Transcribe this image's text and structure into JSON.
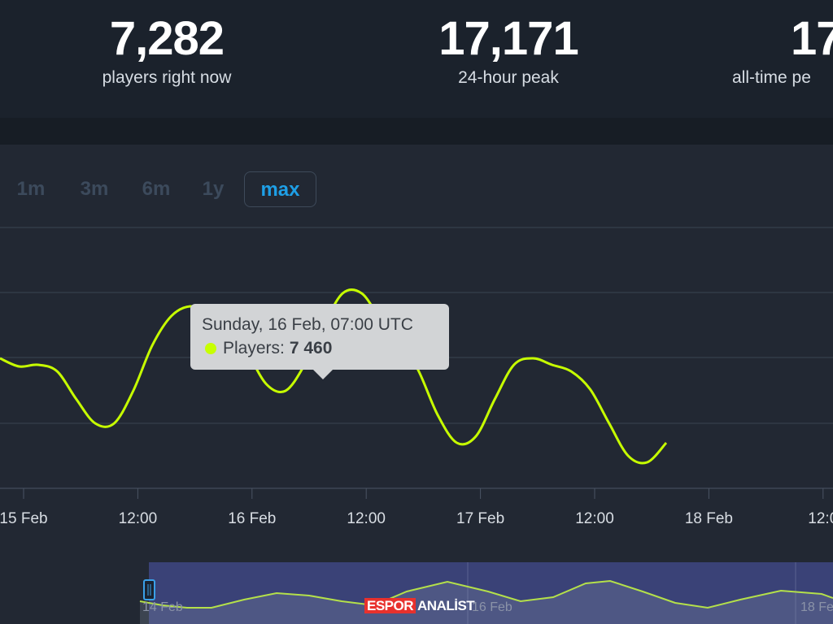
{
  "stats": [
    {
      "value": "7,282",
      "label": "players right now"
    },
    {
      "value": "17,171",
      "label": "24-hour peak"
    },
    {
      "value": "17",
      "label": "all-time pe"
    }
  ],
  "range_buttons": [
    {
      "label": "1m",
      "active": false
    },
    {
      "label": "3m",
      "active": false
    },
    {
      "label": "6m",
      "active": false
    },
    {
      "label": "1y",
      "active": false
    },
    {
      "label": "max",
      "active": true
    }
  ],
  "tooltip": {
    "title": "Sunday, 16 Feb, 07:00 UTC",
    "series": "Players:",
    "value": "7 460"
  },
  "chart_data": {
    "type": "line",
    "series": [
      {
        "name": "Players",
        "color": "#c7ff00",
        "points": [
          [
            0,
            7000
          ],
          [
            2,
            6875
          ],
          [
            4,
            6900
          ],
          [
            6,
            6800
          ],
          [
            8,
            6375
          ],
          [
            10,
            6000
          ],
          [
            12,
            6000
          ],
          [
            14,
            6500
          ],
          [
            16,
            7200
          ],
          [
            18,
            7650
          ],
          [
            20,
            7800
          ],
          [
            22,
            7700
          ],
          [
            24,
            7600
          ],
          [
            26,
            7100
          ],
          [
            28,
            6600
          ],
          [
            30,
            6500
          ],
          [
            32,
            6900
          ],
          [
            34,
            7500
          ],
          [
            36,
            8000
          ],
          [
            38,
            8000
          ],
          [
            40,
            7600
          ],
          [
            42,
            7300
          ],
          [
            44,
            6800
          ],
          [
            46,
            6125
          ],
          [
            48,
            5700
          ],
          [
            50,
            5800
          ],
          [
            52,
            6375
          ],
          [
            54,
            6900
          ],
          [
            56,
            7000
          ],
          [
            58,
            6900
          ],
          [
            60,
            6800
          ],
          [
            62,
            6525
          ],
          [
            64,
            6000
          ],
          [
            66,
            5500
          ],
          [
            68,
            5400
          ],
          [
            70,
            5700
          ]
        ]
      }
    ],
    "x_ticks": [
      {
        "t": 2,
        "label": "15 Feb"
      },
      {
        "t": 14,
        "label": "12:00"
      },
      {
        "t": 26,
        "label": "16 Feb"
      },
      {
        "t": 38,
        "label": "12:00"
      },
      {
        "t": 50,
        "label": "17 Feb"
      },
      {
        "t": 62,
        "label": "12:00"
      },
      {
        "t": 74,
        "label": "18 Feb"
      },
      {
        "t": 86,
        "label": "12:0"
      }
    ],
    "navigator_labels": [
      {
        "t": 0,
        "label": "14 Feb"
      },
      {
        "t": 1,
        "label": "16 Feb"
      },
      {
        "t": 2,
        "label": "18 Feb"
      }
    ],
    "grid": true
  },
  "watermark": {
    "part1": "ESPOR",
    "part2": "ANALİST"
  }
}
